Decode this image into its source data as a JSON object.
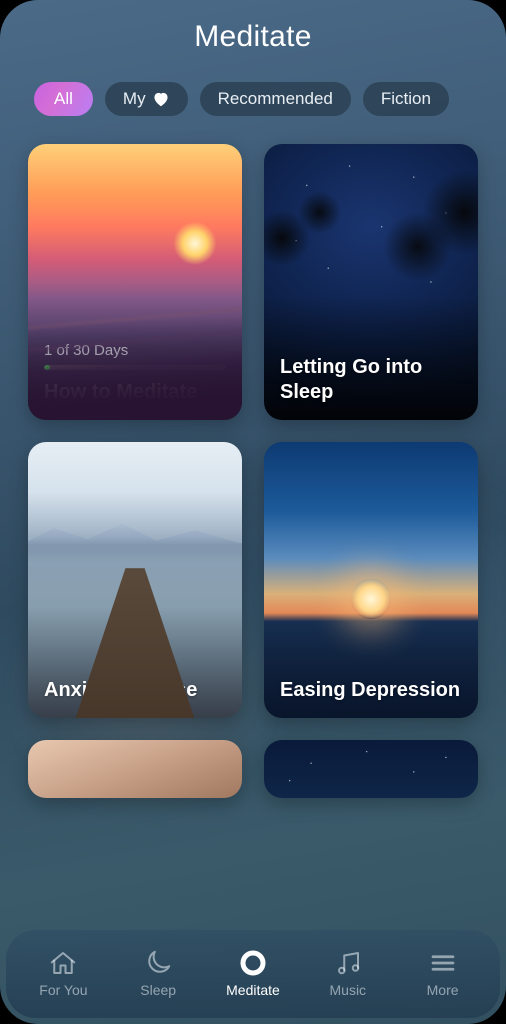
{
  "header": {
    "title": "Meditate"
  },
  "chips": [
    {
      "label": "All",
      "active": true
    },
    {
      "label": "My",
      "has_heart": true
    },
    {
      "label": "Recommended"
    },
    {
      "label": "Fiction"
    }
  ],
  "cards": [
    {
      "title": "How to Meditate",
      "progress_caption": "1 of 30 Days",
      "progress_percent": 3.3,
      "bg": "bg-sunset-mountains"
    },
    {
      "title": "Letting Go into Sleep",
      "bg": "bg-milkyway"
    },
    {
      "title": "Anxiety Release",
      "bg": "bg-lake-dock"
    },
    {
      "title": "Easing Depression",
      "bg": "bg-horizon-sun"
    },
    {
      "bg": "bg-warm-partial",
      "partial": true
    },
    {
      "bg": "bg-stars-partial",
      "partial": true
    }
  ],
  "nav": [
    {
      "label": "For You",
      "icon": "home"
    },
    {
      "label": "Sleep",
      "icon": "moon"
    },
    {
      "label": "Meditate",
      "icon": "circle",
      "active": true
    },
    {
      "label": "Music",
      "icon": "music"
    },
    {
      "label": "More",
      "icon": "menu"
    }
  ]
}
